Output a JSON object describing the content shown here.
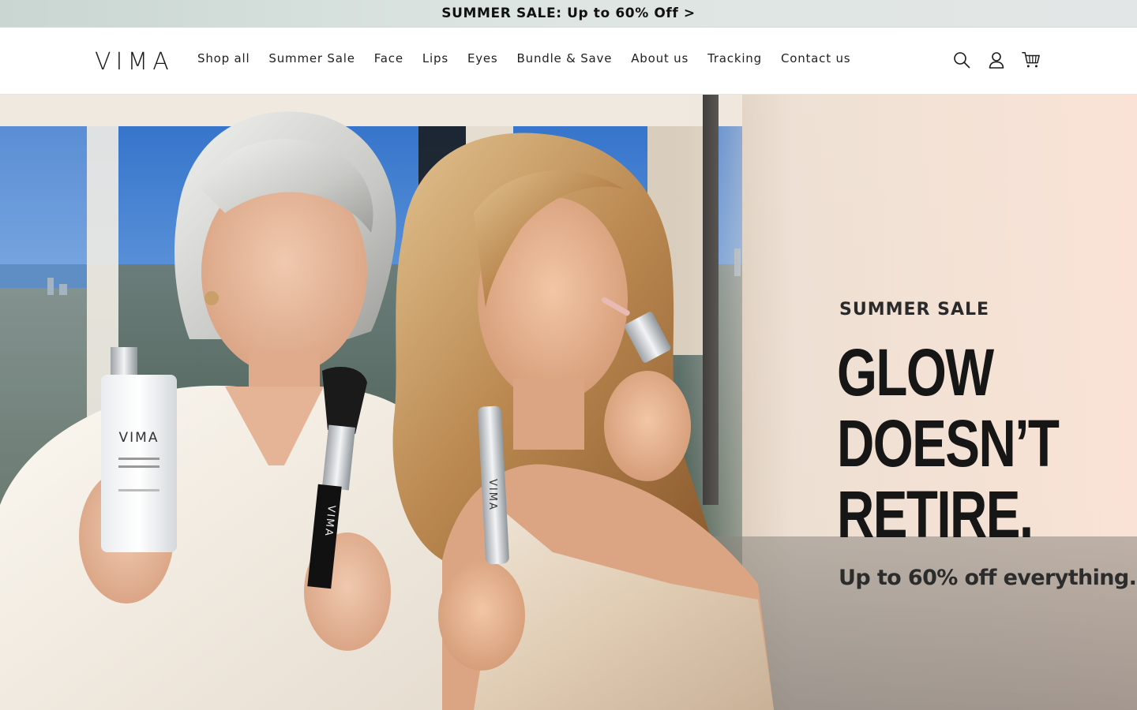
{
  "announcement": {
    "text": "SUMMER SALE: Up to 60% Off >"
  },
  "header": {
    "logo": "VIMA",
    "nav": [
      "Shop all",
      "Summer Sale",
      "Face",
      "Lips",
      "Eyes",
      "Bundle & Save",
      "About us",
      "Tracking",
      "Contact us"
    ],
    "icons": [
      "search-icon",
      "account-icon",
      "cart-icon"
    ]
  },
  "hero": {
    "eyebrow": "SUMMER SALE",
    "headline_line1": "GLOW DOESN’T",
    "headline_line2": "RETIRE.",
    "subhead": "Up to 60% off everything.",
    "product_labels": {
      "foundation": "VIMA",
      "brush": "VIMA",
      "lip_tube": "VIMA"
    }
  },
  "colors": {
    "announcement_bg": "#dde5e2",
    "text_dark": "#161616",
    "hero_peach": "#f6e6dc"
  }
}
